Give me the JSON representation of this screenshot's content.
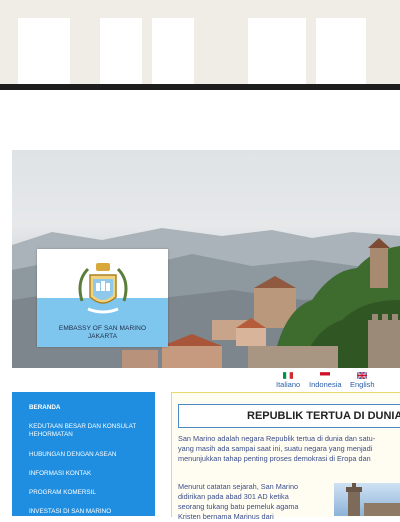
{
  "hero": {
    "emblem_caption_line1": "EMBASSY OF SAN MARINO",
    "emblem_caption_line2": "JAKARTA"
  },
  "languages": [
    {
      "label": "Italiano",
      "flag": "italy-flag"
    },
    {
      "label": "Indonesia",
      "flag": "indonesia-flag"
    },
    {
      "label": "English",
      "flag": "uk-flag"
    }
  ],
  "sidebar": {
    "items": [
      {
        "label": "BERANDA",
        "active": true
      },
      {
        "label": "KEDUTAAN BESAR DAN KONSULAT HEHORMATAN",
        "active": false
      },
      {
        "label": "HUBUNGAN DENGAN ASEAN",
        "active": false
      },
      {
        "label": "INFORMASI KONTAK",
        "active": false
      },
      {
        "label": "PROGRAM KOMERSIL",
        "active": false
      },
      {
        "label": "INVESTASI DI SAN MARINO",
        "active": false
      }
    ]
  },
  "content": {
    "title": "REPUBLIK TERTUA DI DUNIA",
    "intro_lines": [
      "San Marino adalah negara Republik tertua di dunia dan satu-",
      "yang masih ada sampai saat ini, suatu negara yang menjadi",
      "menunjukkan tahap penting proses demokrasi di Eropa dan"
    ],
    "history_lines": [
      "Menurut catatan sejarah, San Marino",
      "didirikan pada abad 301 AD ketika",
      "seorang tukang batu pemeluk agama",
      "Kristen bernama Marinus dari"
    ]
  },
  "colors": {
    "sidebar_bg": "#1f8ee0",
    "flag_blue": "#7fc6ee",
    "title_border": "#4e89c7",
    "content_border": "#e8d96a",
    "text_blue": "#3a4d8a"
  }
}
